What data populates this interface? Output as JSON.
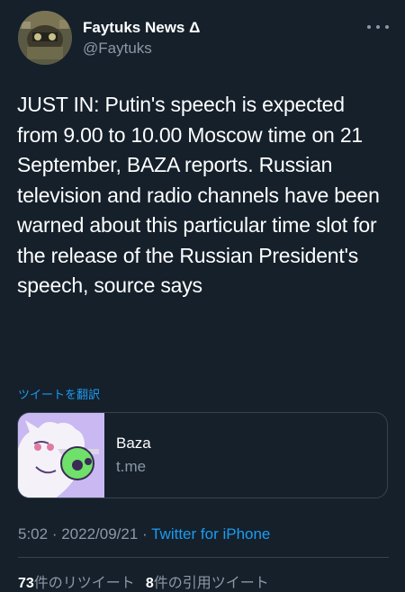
{
  "author": {
    "display_name": "Faytuks News Δ",
    "handle": "@Faytuks"
  },
  "tweet": {
    "text": "JUST IN: Putin's speech is expected from 9.00 to 10.00 Moscow time on 21 September, BAZA reports. Russian television and radio channels have been warned about this particular time slot for the release of the Russian President's speech, source says",
    "translate_label": "ツイートを翻訳"
  },
  "card": {
    "title": "Baza",
    "domain": "t.me"
  },
  "meta": {
    "time": "5:02",
    "sep1": " · ",
    "date": "2022/09/21",
    "sep2": " · ",
    "source": "Twitter for iPhone"
  },
  "stats": {
    "retweets_count": "73",
    "retweets_label": "件のリツイート",
    "quotes_count": "8",
    "quotes_label": "件の引用ツイート"
  },
  "colors": {
    "background": "#15202b",
    "link": "#1d9bf0",
    "secondary_text": "#8b98a5",
    "border": "#38444d"
  },
  "icons": {
    "more": "more-horizontal-icon"
  }
}
